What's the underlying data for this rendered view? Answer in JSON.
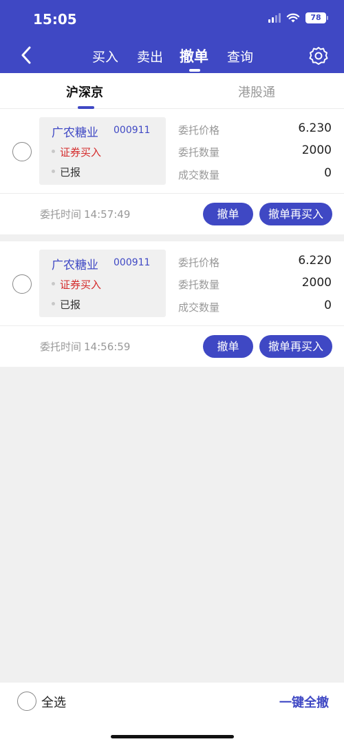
{
  "status_bar": {
    "time": "15:05",
    "battery": "78"
  },
  "nav": {
    "tabs": [
      {
        "label": "买入"
      },
      {
        "label": "卖出"
      },
      {
        "label": "撤单"
      },
      {
        "label": "查询"
      }
    ],
    "active_tab": "撤单",
    "icons": {
      "back": "chevron-left-icon",
      "settings": "gear-icon"
    }
  },
  "market_tabs": [
    {
      "label": "沪深京",
      "active": true
    },
    {
      "label": "港股通",
      "active": false
    }
  ],
  "orders": [
    {
      "stock_name": "广农糖业",
      "stock_code": "000911",
      "order_type": "证券买入",
      "status": "已报",
      "fields": [
        {
          "label": "委托价格",
          "value": "6.230"
        },
        {
          "label": "委托数量",
          "value": "2000"
        },
        {
          "label": "成交数量",
          "value": "0"
        }
      ],
      "time_label": "委托时间",
      "time": "14:57:49",
      "cancel_label": "撤单",
      "cancel_rebuy_label": "撤单再买入"
    },
    {
      "stock_name": "广农糖业",
      "stock_code": "000911",
      "order_type": "证券买入",
      "status": "已报",
      "fields": [
        {
          "label": "委托价格",
          "value": "6.220"
        },
        {
          "label": "委托数量",
          "value": "2000"
        },
        {
          "label": "成交数量",
          "value": "0"
        }
      ],
      "time_label": "委托时间",
      "time": "14:56:59",
      "cancel_label": "撤单",
      "cancel_rebuy_label": "撤单再买入"
    }
  ],
  "bottom_bar": {
    "select_all_label": "全选",
    "cancel_all_label": "一键全撤"
  },
  "colors": {
    "primary": "#3f48c4",
    "buy_red": "#d42a2a",
    "background": "#f0f0f0"
  }
}
